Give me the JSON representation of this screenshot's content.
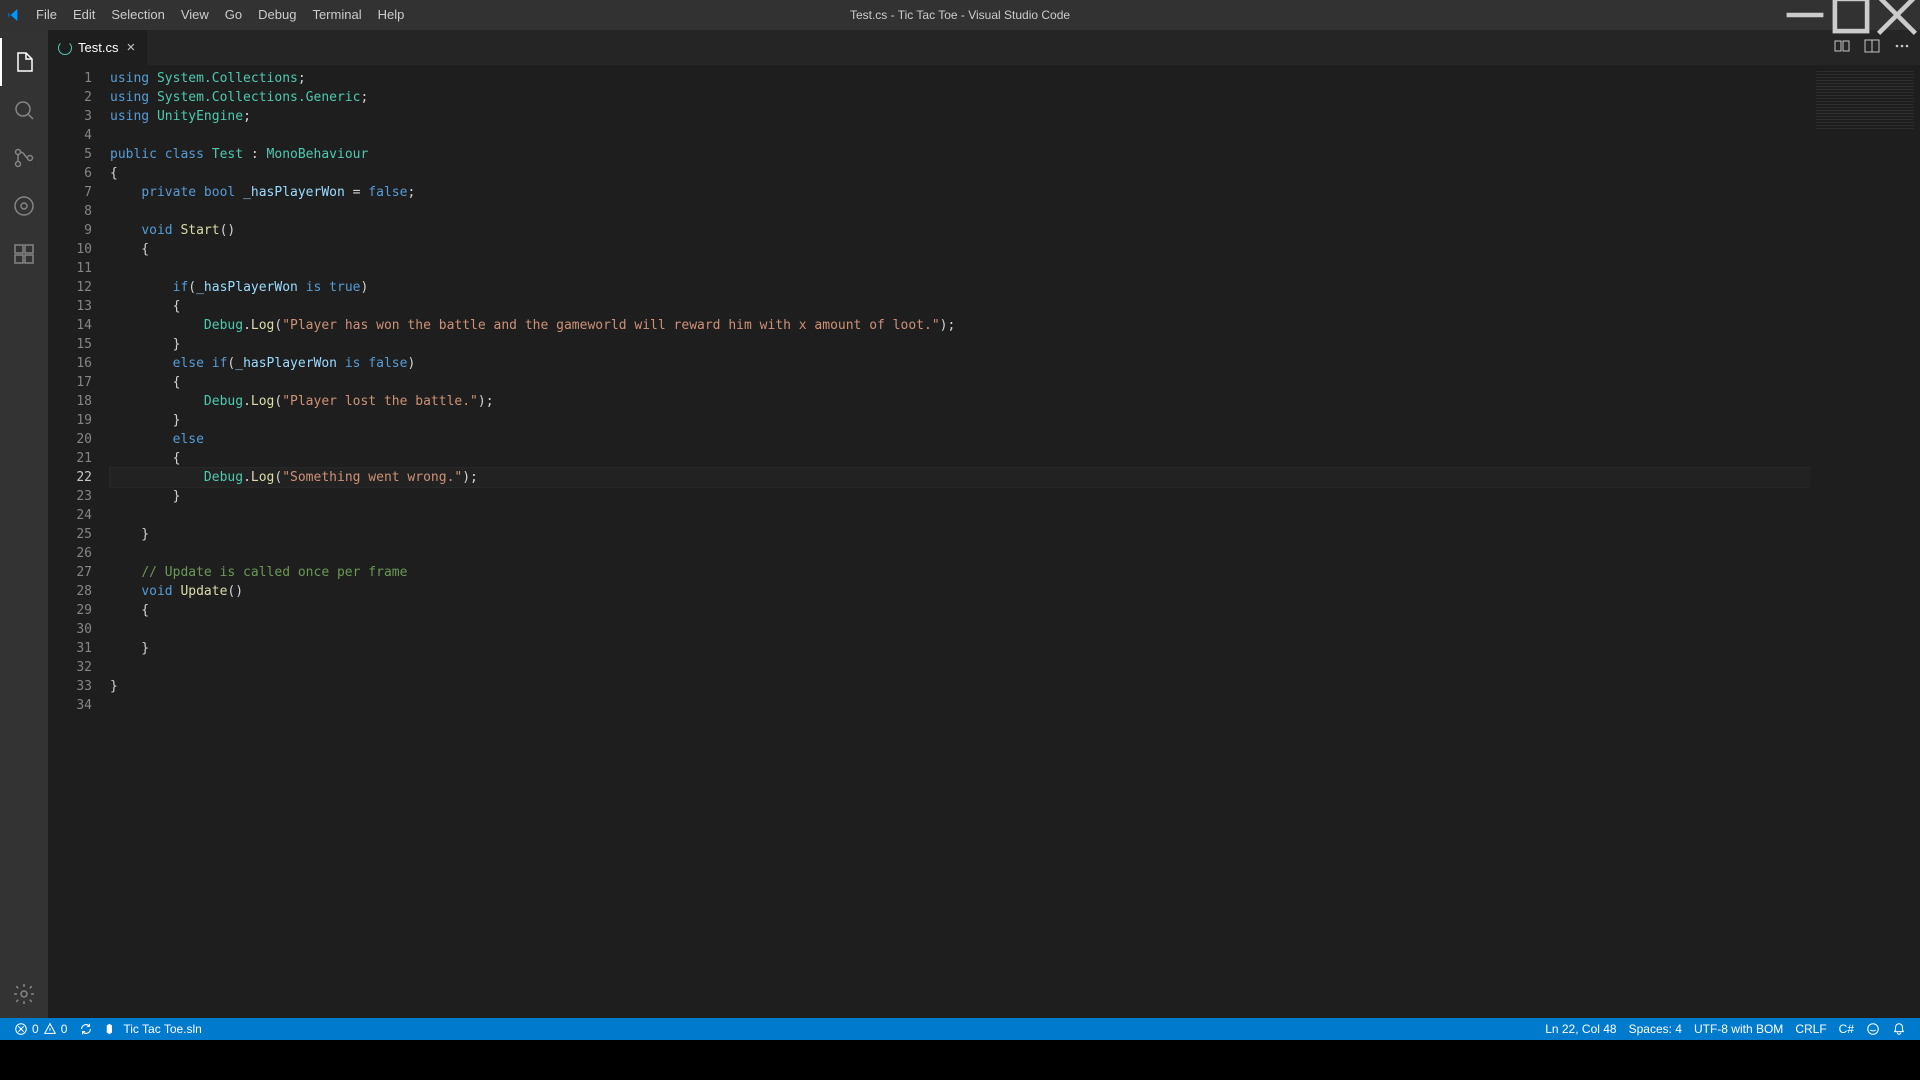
{
  "title": "Test.cs - Tic Tac Toe - Visual Studio Code",
  "menu": [
    "File",
    "Edit",
    "Selection",
    "View",
    "Go",
    "Debug",
    "Terminal",
    "Help"
  ],
  "tab": {
    "label": "Test.cs"
  },
  "activity": [
    "files-icon",
    "search-icon",
    "source-control-icon",
    "debug-alt-icon",
    "extensions-icon"
  ],
  "code_lines": [
    [
      {
        "t": "using ",
        "c": "kw"
      },
      {
        "t": "System.Collections",
        "c": "cls"
      },
      {
        "t": ";",
        "c": "pun"
      }
    ],
    [
      {
        "t": "using ",
        "c": "kw"
      },
      {
        "t": "System.Collections.Generic",
        "c": "cls"
      },
      {
        "t": ";",
        "c": "pun"
      }
    ],
    [
      {
        "t": "using ",
        "c": "kw"
      },
      {
        "t": "UnityEngine",
        "c": "cls"
      },
      {
        "t": ";",
        "c": "pun"
      }
    ],
    [],
    [
      {
        "t": "public class ",
        "c": "kw"
      },
      {
        "t": "Test",
        "c": "cls"
      },
      {
        "t": " : ",
        "c": "pun"
      },
      {
        "t": "MonoBehaviour",
        "c": "cls"
      }
    ],
    [
      {
        "t": "{",
        "c": "pun"
      }
    ],
    [
      {
        "t": "    ",
        "c": "pun"
      },
      {
        "t": "private bool ",
        "c": "kw"
      },
      {
        "t": "_hasPlayerWon",
        "c": "var"
      },
      {
        "t": " = ",
        "c": "pun"
      },
      {
        "t": "false",
        "c": "kw"
      },
      {
        "t": ";",
        "c": "pun"
      }
    ],
    [],
    [
      {
        "t": "    ",
        "c": "pun"
      },
      {
        "t": "void ",
        "c": "kw"
      },
      {
        "t": "Start",
        "c": "fn"
      },
      {
        "t": "()",
        "c": "pun"
      }
    ],
    [
      {
        "t": "    {",
        "c": "pun"
      }
    ],
    [],
    [
      {
        "t": "        ",
        "c": "pun"
      },
      {
        "t": "if",
        "c": "kw"
      },
      {
        "t": "(",
        "c": "pun"
      },
      {
        "t": "_hasPlayerWon",
        "c": "var"
      },
      {
        "t": " ",
        "c": "pun"
      },
      {
        "t": "is ",
        "c": "kw"
      },
      {
        "t": "true",
        "c": "kw"
      },
      {
        "t": ")",
        "c": "pun"
      }
    ],
    [
      {
        "t": "        {",
        "c": "pun"
      }
    ],
    [
      {
        "t": "            ",
        "c": "pun"
      },
      {
        "t": "Debug",
        "c": "cls"
      },
      {
        "t": ".",
        "c": "pun"
      },
      {
        "t": "Log",
        "c": "fn"
      },
      {
        "t": "(",
        "c": "pun"
      },
      {
        "t": "\"Player has won the battle and the gameworld will reward him with x amount of loot.\"",
        "c": "str"
      },
      {
        "t": ");",
        "c": "pun"
      }
    ],
    [
      {
        "t": "        }",
        "c": "pun"
      }
    ],
    [
      {
        "t": "        ",
        "c": "pun"
      },
      {
        "t": "else if",
        "c": "kw"
      },
      {
        "t": "(",
        "c": "pun"
      },
      {
        "t": "_hasPlayerWon",
        "c": "var"
      },
      {
        "t": " ",
        "c": "pun"
      },
      {
        "t": "is ",
        "c": "kw"
      },
      {
        "t": "false",
        "c": "kw"
      },
      {
        "t": ")",
        "c": "pun"
      }
    ],
    [
      {
        "t": "        {",
        "c": "pun"
      }
    ],
    [
      {
        "t": "            ",
        "c": "pun"
      },
      {
        "t": "Debug",
        "c": "cls"
      },
      {
        "t": ".",
        "c": "pun"
      },
      {
        "t": "Log",
        "c": "fn"
      },
      {
        "t": "(",
        "c": "pun"
      },
      {
        "t": "\"Player lost the battle.\"",
        "c": "str"
      },
      {
        "t": ");",
        "c": "pun"
      }
    ],
    [
      {
        "t": "        }",
        "c": "pun"
      }
    ],
    [
      {
        "t": "        ",
        "c": "pun"
      },
      {
        "t": "else",
        "c": "kw"
      }
    ],
    [
      {
        "t": "        {",
        "c": "pun"
      }
    ],
    [
      {
        "t": "            ",
        "c": "pun"
      },
      {
        "t": "Debug",
        "c": "cls"
      },
      {
        "t": ".",
        "c": "pun"
      },
      {
        "t": "Log",
        "c": "fn"
      },
      {
        "t": "(",
        "c": "pun"
      },
      {
        "t": "\"Something went wrong.\"",
        "c": "str"
      },
      {
        "t": ");",
        "c": "pun"
      }
    ],
    [
      {
        "t": "        }",
        "c": "pun"
      }
    ],
    [],
    [
      {
        "t": "    }",
        "c": "pun"
      }
    ],
    [],
    [
      {
        "t": "    ",
        "c": "pun"
      },
      {
        "t": "// Update is called once per frame",
        "c": "cmt"
      }
    ],
    [
      {
        "t": "    ",
        "c": "pun"
      },
      {
        "t": "void ",
        "c": "kw"
      },
      {
        "t": "Update",
        "c": "fn"
      },
      {
        "t": "()",
        "c": "pun"
      }
    ],
    [
      {
        "t": "    {",
        "c": "pun"
      }
    ],
    [
      {
        "t": "        ",
        "c": "pun"
      }
    ],
    [
      {
        "t": "    }",
        "c": "pun"
      }
    ],
    [],
    [
      {
        "t": "}",
        "c": "pun"
      }
    ],
    []
  ],
  "current_line": 22,
  "status": {
    "errors": "0",
    "warnings": "0",
    "solution": "Tic Tac Toe.sln",
    "cursor": "Ln 22, Col 48",
    "spaces": "Spaces: 4",
    "encoding": "UTF-8 with BOM",
    "eol": "CRLF",
    "lang": "C#"
  }
}
